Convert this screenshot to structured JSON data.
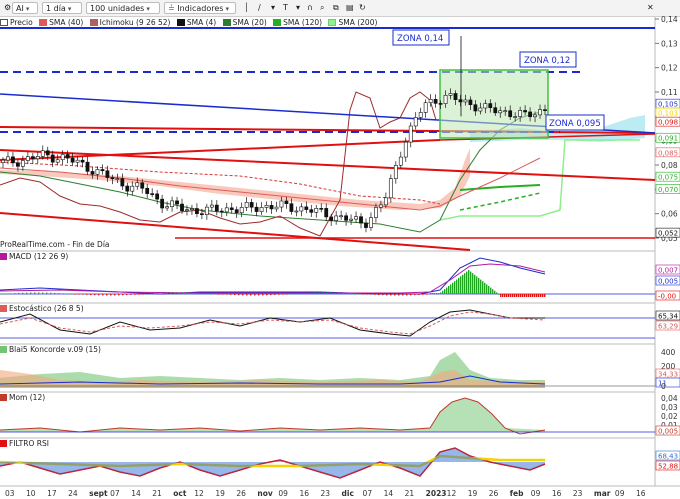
{
  "toolbar": {
    "symbol": "AI",
    "period": "1 día",
    "units": "100 unidades",
    "indicators": "Indicadores"
  },
  "legend": {
    "price": "Precio",
    "sma40": "SMA (40)",
    "ichimoku": "Ichimoku (9 26 52)",
    "sma4": "SMA (4)",
    "sma20": "SMA (20)",
    "sma120": "SMA (120)",
    "sma200": "SMA (200)"
  },
  "source_note": "ProRealTime.com - Fin de Día",
  "panels": {
    "macd": "MACD (12 26 9)",
    "stoch": "Estocástico (26 8 5)",
    "blai5": "Blai5 Koncorde v.09 (15)",
    "mom": "Mom (12)",
    "rsi": "FILTRO RSI"
  },
  "zones": {
    "z014": "ZONA 0,14",
    "z012": "ZONA 0,12",
    "z0095": "ZONA 0,095"
  },
  "chart_data": {
    "type": "line",
    "title": "",
    "price_axis": {
      "ylim": [
        0.05,
        0.14
      ],
      "ticks": [
        "0,14",
        "0,13",
        "0,12",
        "0,11",
        "0,10",
        "0,09",
        "0,08",
        "0,07",
        "0,06",
        "0,05"
      ]
    },
    "value_tags": [
      "0,105",
      "0,103",
      "0,098",
      "0,091",
      "0,085",
      "0,075",
      "0,070",
      "0,052"
    ],
    "x_labels": [
      "03",
      "10",
      "17",
      "24",
      "sept",
      "07",
      "14",
      "21",
      "oct",
      "12",
      "19",
      "26",
      "nov",
      "09",
      "16",
      "23",
      "dic",
      "07",
      "14",
      "21",
      "2023",
      "12",
      "19",
      "26",
      "feb",
      "09",
      "16",
      "23",
      "mar",
      "09",
      "16"
    ],
    "colors": {
      "zone_blue": "#1a2ccf",
      "channel_red": "#e01010",
      "zone_box": "#3ec23e",
      "ichimoku_cloud": "#9fe3f0",
      "sma200": "#8df08d"
    },
    "series": [
      {
        "name": "Precio",
        "values": [
          0.081,
          0.082,
          0.084,
          0.083,
          0.08,
          0.076,
          0.072,
          0.07,
          0.064,
          0.062,
          0.061,
          0.062,
          0.062,
          0.063,
          0.063,
          0.062,
          0.06,
          0.058,
          0.056,
          0.065,
          0.09,
          0.105,
          0.108,
          0.106,
          0.103,
          0.102,
          0.1,
          0.103
        ]
      },
      {
        "name": "SMA (4)",
        "values": [
          0.081,
          0.082,
          0.083,
          0.083,
          0.081,
          0.077,
          0.073,
          0.07,
          0.065,
          0.063,
          0.062,
          0.062,
          0.062,
          0.063,
          0.063,
          0.062,
          0.06,
          0.058,
          0.057,
          0.062,
          0.085,
          0.103,
          0.107,
          0.106,
          0.104,
          0.103,
          0.101,
          0.102
        ]
      },
      {
        "name": "SMA (40)",
        "values": [
          0.083,
          0.083,
          0.082,
          0.081,
          0.08,
          0.078,
          0.076,
          0.074,
          0.071,
          0.069,
          0.067,
          0.066,
          0.065,
          0.064,
          0.064,
          0.064,
          0.063,
          0.062,
          0.061,
          0.061,
          0.066,
          0.075,
          0.083,
          0.09,
          0.095,
          0.098,
          0.099,
          0.1
        ]
      },
      {
        "name": "SMA (200)",
        "values": [
          0.091,
          0.091,
          0.091,
          0.091,
          0.091,
          0.091,
          0.091,
          0.091,
          0.091,
          0.091,
          0.091,
          0.091,
          0.091,
          0.091,
          0.091,
          0.091,
          0.091,
          0.091,
          0.091,
          0.091,
          0.091,
          0.091,
          0.091,
          0.091,
          0.091,
          0.091,
          0.091,
          0.091
        ]
      }
    ]
  },
  "indicators": {
    "macd_tags": [
      "0,007",
      "0,005",
      "-0,00"
    ],
    "stoch_tags": [
      "65,34",
      "63,29"
    ],
    "blai5_ticks": [
      "400",
      "200",
      "0"
    ],
    "blai5_tags": [
      "34,33",
      "11"
    ],
    "mom_ticks": [
      "0,04",
      "0,03",
      "0,02",
      "0,01"
    ],
    "mom_tags": [
      "0,005"
    ],
    "rsi_tags": [
      "68,43",
      "52,88"
    ]
  }
}
